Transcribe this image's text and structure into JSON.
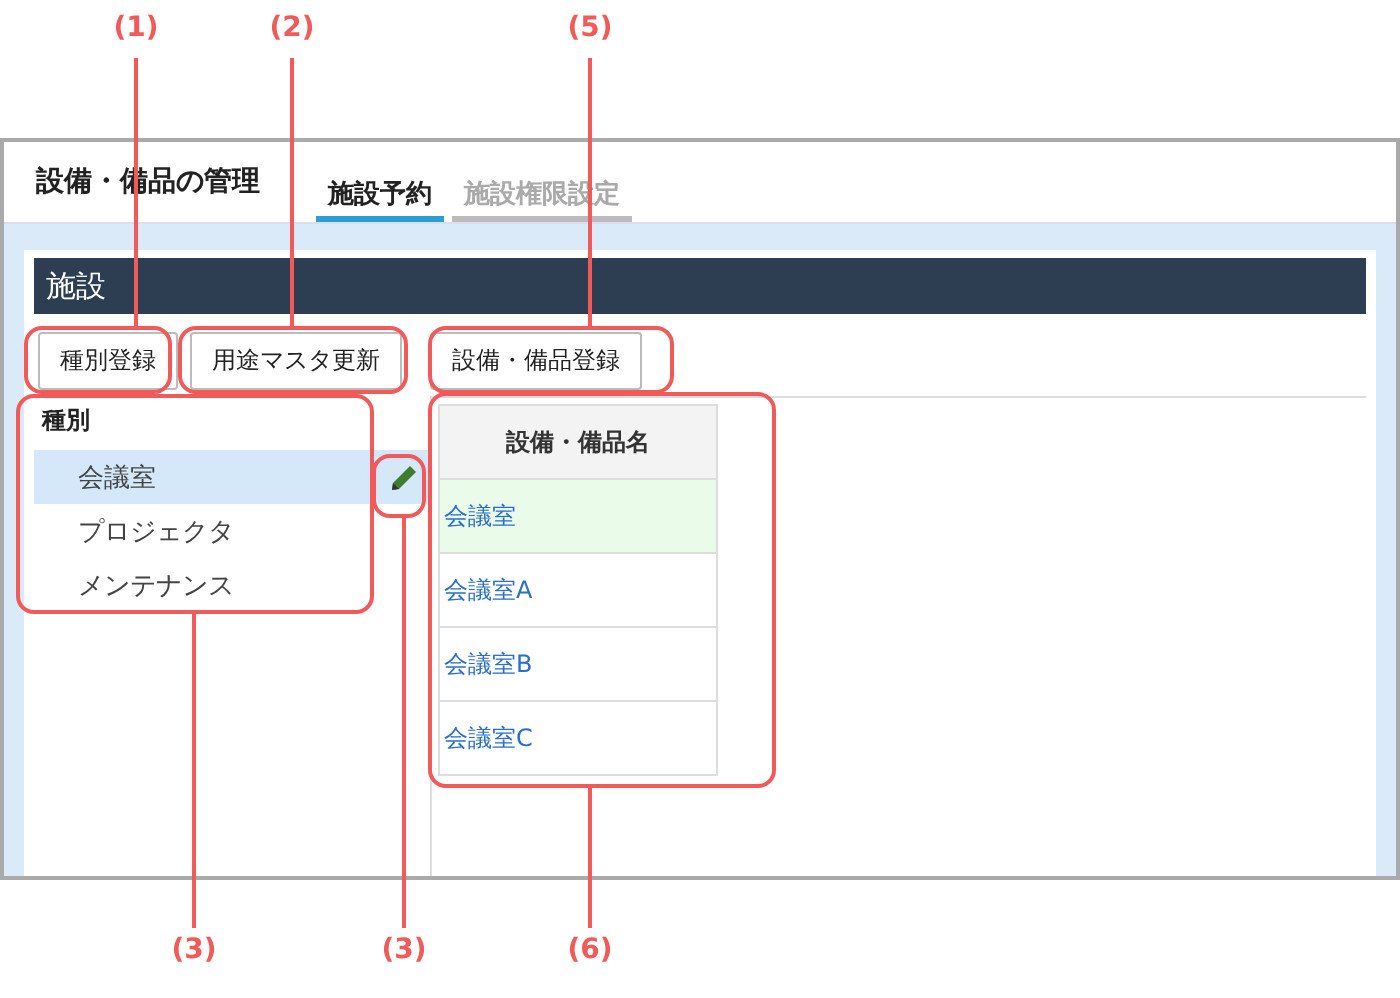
{
  "window": {
    "title": "設備・備品の管理"
  },
  "tabs": [
    {
      "label": "施設予約",
      "selected": true
    },
    {
      "label": "施設権限設定",
      "selected": false
    }
  ],
  "section": {
    "title": "施設"
  },
  "buttons": [
    "種別登録",
    "用途マスタ更新",
    "設備・備品登録"
  ],
  "category_list": {
    "heading": "種別",
    "items": [
      {
        "label": "会議室",
        "selected": true
      },
      {
        "label": "プロジェクタ",
        "selected": false
      },
      {
        "label": "メンテナンス",
        "selected": false
      }
    ]
  },
  "table": {
    "columns": [
      "設備・備品名"
    ],
    "rows": [
      {
        "name": "会議室",
        "selected": true
      },
      {
        "name": "会議室A",
        "selected": false
      },
      {
        "name": "会議室B",
        "selected": false
      },
      {
        "name": "会議室C",
        "selected": false
      }
    ]
  },
  "annotations": [
    {
      "label": "(1)"
    },
    {
      "label": "(2)"
    },
    {
      "label": "(5)"
    },
    {
      "label": "(3)"
    },
    {
      "label": "(3)"
    },
    {
      "label": "(6)"
    }
  ]
}
